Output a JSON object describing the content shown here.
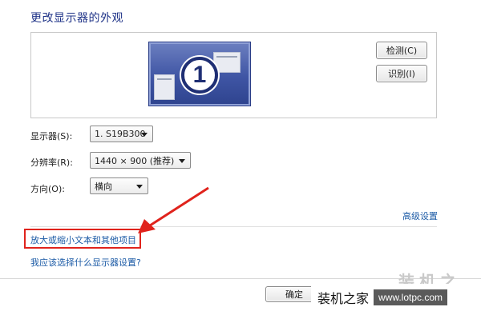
{
  "page_title": "更改显示器的外观",
  "preview": {
    "monitor_number": "1"
  },
  "buttons": {
    "detect": "检测(C)",
    "identify": "识别(I)",
    "ok": "确定"
  },
  "fields": [
    {
      "label": "显示器(S):",
      "value": "1. S19B300"
    },
    {
      "label": "分辨率(R):",
      "value": "1440 × 900 (推荐)"
    },
    {
      "label": "方向(O):",
      "value": "横向"
    }
  ],
  "links": {
    "advanced": "高级设置",
    "enlarge_text": "放大或缩小文本和其他项目",
    "which_settings": "我应该选择什么显示器设置?"
  },
  "colors": {
    "highlight": "#e0231c",
    "link": "#1c5ba6",
    "title": "#1e3287"
  },
  "watermark": {
    "text": "装机之家",
    "big_text": "装机之家",
    "url": "www.lotpc.com"
  }
}
